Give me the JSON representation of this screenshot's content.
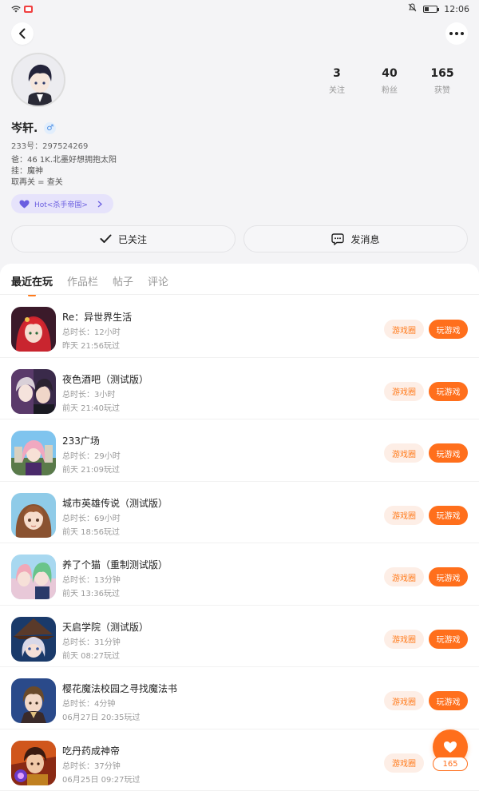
{
  "status_bar": {
    "time": "12:06"
  },
  "profile": {
    "username": "岑轩.",
    "gender_symbol": "♂",
    "uid": "233号：297524269",
    "bio_lines": [
      "爸：46 1K.北墨好想拥抱太阳",
      "挂：魔神",
      "取再关 = 查关"
    ],
    "hot_badge": "Hot<杀手帝国>",
    "stats": [
      {
        "value": "3",
        "label": "关注"
      },
      {
        "value": "40",
        "label": "粉丝"
      },
      {
        "value": "165",
        "label": "获赞"
      }
    ]
  },
  "actions": {
    "followed_label": "已关注",
    "message_label": "发消息"
  },
  "tabs": [
    {
      "label": "最近在玩",
      "active": true
    },
    {
      "label": "作品栏",
      "active": false
    },
    {
      "label": "帖子",
      "active": false
    },
    {
      "label": "评论",
      "active": false
    }
  ],
  "buttons": {
    "circle": "游戏圈",
    "play": "玩游戏"
  },
  "games": [
    {
      "title": "Re：异世界生活",
      "duration": "总时长：12小时",
      "last_played": "昨天 21:56玩过"
    },
    {
      "title": "夜色酒吧（测试版）",
      "duration": "总时长：3小时",
      "last_played": "前天 21:40玩过"
    },
    {
      "title": "233广场",
      "duration": "总时长：29小时",
      "last_played": "前天 21:09玩过"
    },
    {
      "title": "城市英雄传说（测试版）",
      "duration": "总时长：69小时",
      "last_played": "前天 18:56玩过"
    },
    {
      "title": "养了个猫（重制测试版）",
      "duration": "总时长：13分钟",
      "last_played": "前天 13:36玩过"
    },
    {
      "title": "天启学院（测试版）",
      "duration": "总时长：31分钟",
      "last_played": "前天 08:27玩过"
    },
    {
      "title": "樱花魔法校园之寻找魔法书",
      "duration": "总时长：4分钟",
      "last_played": "06月27日 20:35玩过"
    },
    {
      "title": "吃丹药成神帝",
      "duration": "总时长：37分钟",
      "last_played": "06月25日 09:27玩过"
    }
  ],
  "like_fab": {
    "count": "165"
  },
  "colors": {
    "accent": "#ff6f1c",
    "accent_light": "#fdeee6",
    "badge_purple": "#6a5ee0"
  }
}
